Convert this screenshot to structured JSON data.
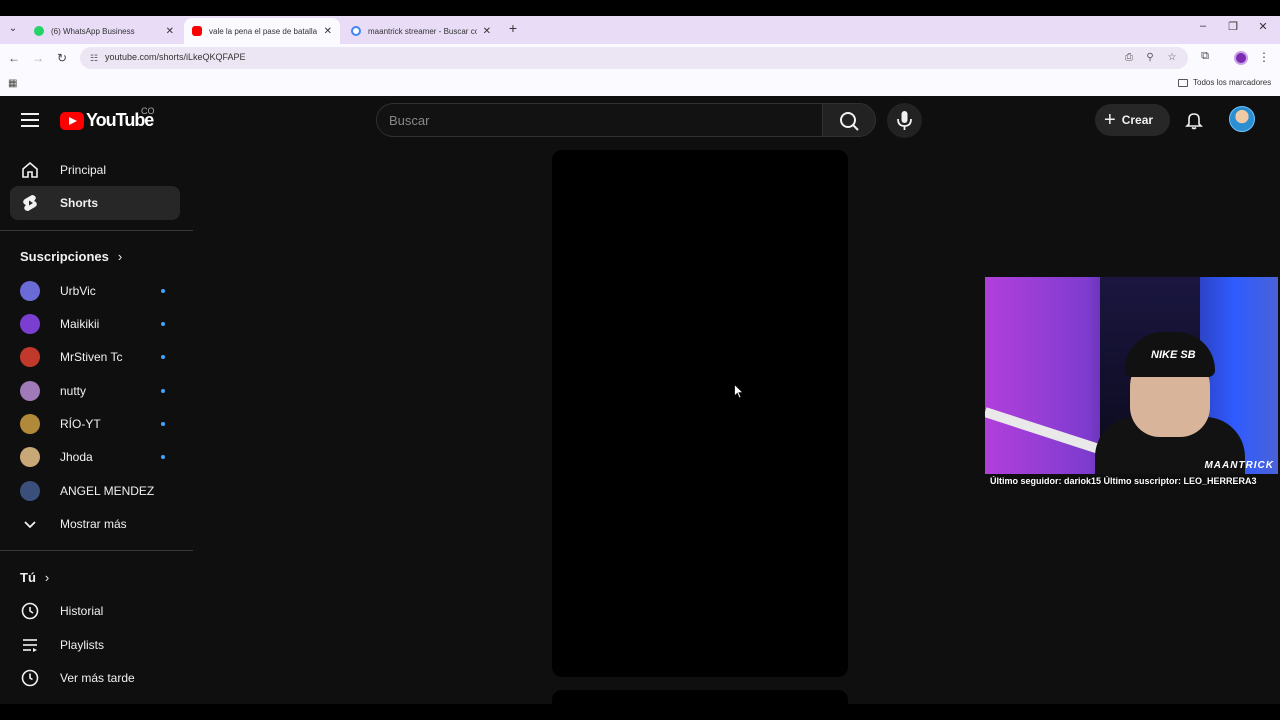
{
  "browser": {
    "tabs": [
      {
        "title": "(6) WhatsApp Business",
        "favicon_color": "#25d366",
        "active": false
      },
      {
        "title": "vale la pena el pase de batalla ?",
        "favicon_color": "#ff0000",
        "active": true
      },
      {
        "title": "maantrick streamer - Buscar con Google",
        "favicon_color": "#4285f4",
        "active": false
      }
    ],
    "url": "youtube.com/shorts/iLkeQKQFAPE",
    "bookmarks_folder": "Todos los marcadores"
  },
  "youtube": {
    "logo_text": "YouTube",
    "country_code": "CO",
    "search_placeholder": "Buscar",
    "create_label": "Crear",
    "sidebar": {
      "main": [
        {
          "label": "Principal",
          "icon": "home-icon"
        },
        {
          "label": "Shorts",
          "icon": "shorts-icon",
          "active": true
        }
      ],
      "subscriptions_heading": "Suscripciones",
      "subscriptions": [
        {
          "label": "UrbVic",
          "avatar_color": "#6b6bd8",
          "new": true
        },
        {
          "label": "Maikikii",
          "avatar_color": "#7a3fd1",
          "new": true
        },
        {
          "label": "MrStiven Tc",
          "avatar_color": "#c0392b",
          "new": true
        },
        {
          "label": "nutty",
          "avatar_color": "#a07ab8",
          "new": true
        },
        {
          "label": "RÍO-YT",
          "avatar_color": "#b08a3a",
          "new": true
        },
        {
          "label": "Jhoda",
          "avatar_color": "#c9a878",
          "new": true
        },
        {
          "label": "ANGEL MENDEZ",
          "avatar_color": "#3a4f7a",
          "new": false
        }
      ],
      "show_more": "Mostrar más",
      "you_heading": "Tú",
      "you": [
        {
          "label": "Historial",
          "icon": "history-icon"
        },
        {
          "label": "Playlists",
          "icon": "playlists-icon"
        },
        {
          "label": "Ver más tarde",
          "icon": "watch-later-icon"
        }
      ]
    }
  },
  "stream_overlay": {
    "ticker": "Último seguidor: dariok15 Último suscriptor: LEO_HERRERA3",
    "brand": "MAANTRICK",
    "cap_logo": "NIKE SB"
  }
}
